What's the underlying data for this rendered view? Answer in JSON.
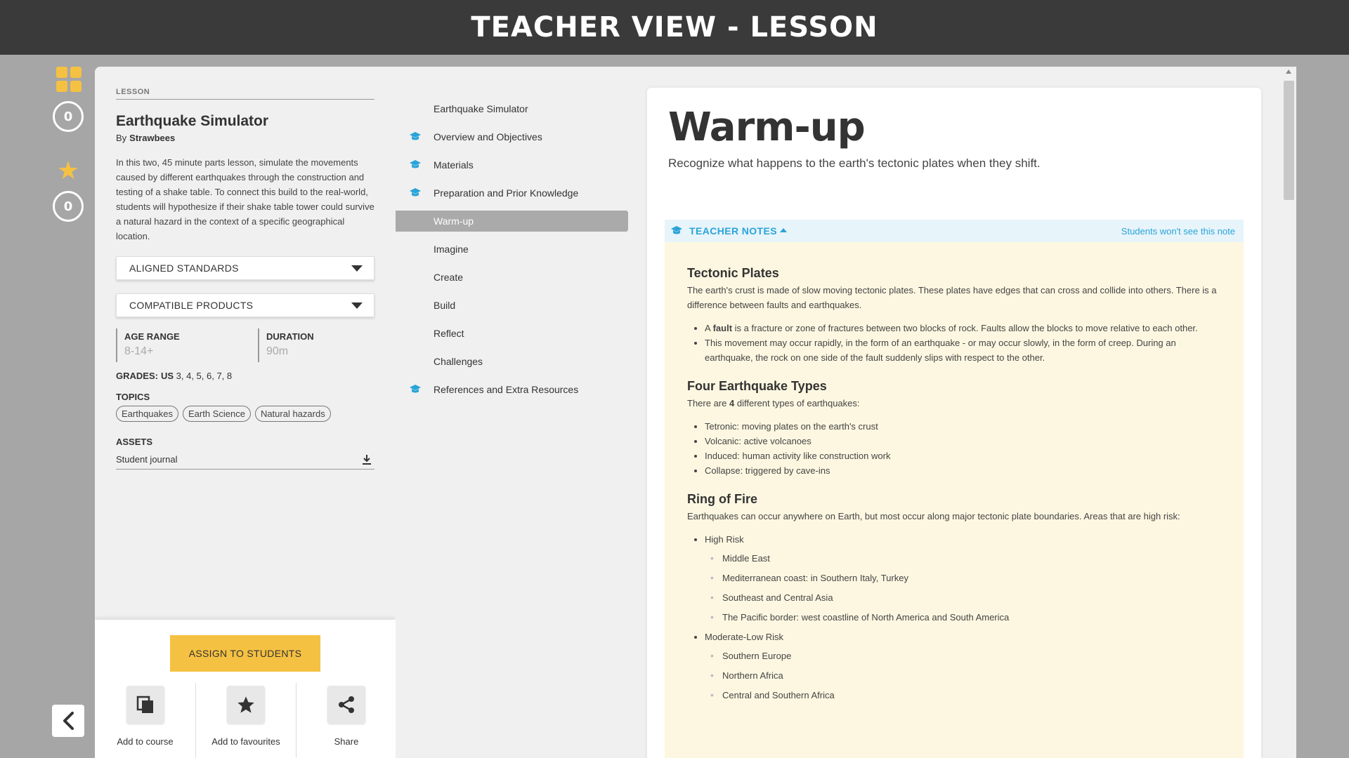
{
  "header": {
    "title": "TEACHER VIEW - LESSON"
  },
  "rail": {
    "count_a": "0",
    "count_b": "0"
  },
  "lesson": {
    "tag": "LESSON",
    "title": "Earthquake Simulator",
    "by_label": "By",
    "author": "Strawbees",
    "description": "In this two, 45 minute parts lesson, simulate the movements caused by different earthquakes through the construction and testing of a shake table. To connect this build to the real-world, students will hypothesize if their shake table tower could survive a natural hazard in the context of a specific geographical location.",
    "dropdown_standards": "ALIGNED STANDARDS",
    "dropdown_products": "COMPATIBLE PRODUCTS",
    "age_label": "AGE RANGE",
    "age_value": "8-14+",
    "duration_label": "DURATION",
    "duration_value": "90m",
    "grades_label": "GRADES:",
    "grades_region": "US",
    "grades_values": "3, 4, 5, 6, 7, 8",
    "topics_label": "TOPICS",
    "topics": [
      "Earthquakes",
      "Earth Science",
      "Natural hazards"
    ],
    "assets_label": "ASSETS",
    "asset_name": "Student journal"
  },
  "actions": {
    "assign": "ASSIGN TO STUDENTS",
    "add_course": "Add to course",
    "add_favourites": "Add to favourites",
    "share": "Share"
  },
  "nav": {
    "items": [
      {
        "label": "Earthquake Simulator"
      },
      {
        "label": "Overview and Objectives"
      },
      {
        "label": "Materials"
      },
      {
        "label": "Preparation and Prior Knowledge"
      },
      {
        "label": "Warm-up"
      },
      {
        "label": "Imagine"
      },
      {
        "label": "Create"
      },
      {
        "label": "Build"
      },
      {
        "label": "Reflect"
      },
      {
        "label": "Challenges"
      },
      {
        "label": "References and Extra Resources"
      }
    ]
  },
  "content": {
    "title": "Warm-up",
    "subtitle": "Recognize what happens to the earth's tectonic plates when they shift.",
    "notes_title": "TEACHER NOTES",
    "notes_hint": "Students won't see this note",
    "s1_title": "Tectonic Plates",
    "s1_p": "The earth's crust is made of slow moving tectonic plates. These plates have edges that can cross and collide into others. There is a difference between faults and earthquakes.",
    "s1_b1_pre": "A",
    "s1_b1_bold": "fault",
    "s1_b1_rest": "is a fracture or zone of fractures between two blocks of rock. Faults allow the blocks to move relative to each other.",
    "s1_b2": "This movement may occur rapidly, in the form of an earthquake - or may occur slowly, in the form of creep. During an earthquake, the rock on one side of the fault suddenly slips with respect to the other.",
    "s2_title": "Four Earthquake Types",
    "s2_p_pre": "There are",
    "s2_p_bold": "4",
    "s2_p_rest": "different types of earthquakes:",
    "s2_items": [
      "Tetronic: moving plates on the earth's crust",
      "Volcanic: active volcanoes",
      "Induced: human activity like construction work",
      "Collapse: triggered by cave-ins"
    ],
    "s3_title": "Ring of Fire",
    "s3_p": "Earthquakes can occur anywhere on Earth, but most occur along major tectonic plate boundaries. Areas that are high risk:",
    "s3_high": "High Risk",
    "s3_high_items": [
      "Middle East",
      "Mediterranean coast: in Southern Italy, Turkey",
      "Southeast and Central Asia",
      "The Pacific border: west coastline of North America and South America"
    ],
    "s3_mod": "Moderate-Low Risk",
    "s3_mod_items": [
      "Southern Europe",
      "Northern Africa",
      "Central and Southern Africa"
    ]
  }
}
